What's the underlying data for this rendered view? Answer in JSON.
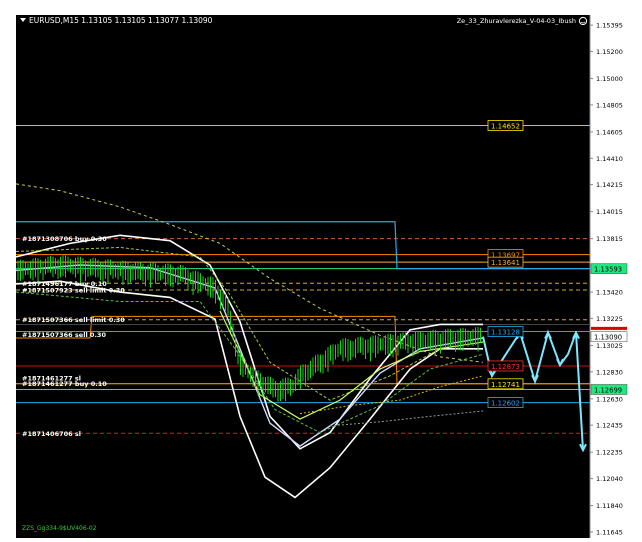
{
  "header": {
    "title": "EURUSD,M15  1.13105 1.13105 1.13077 1.13090",
    "indicator": "Ze_33_Zhuravlerezka_V-04-03_Ibush"
  },
  "footer": {
    "label": "ZZS_Gg334-9$UV406-02"
  },
  "colors": {
    "background": "#000000",
    "axis": "#c8c8c8",
    "candles": "#22cc22",
    "envelope": "#ffffff",
    "inner_band": "#cfd8ff",
    "ma_fast": "#ccff66",
    "ma_slow": "#9acd32",
    "forecast": "#7fe6ff",
    "green_line": "#20e880",
    "cyan_line": "#22aaee",
    "red_line": "#cc1111",
    "gold_line": "#e8c000",
    "orange_line": "#ff8800"
  },
  "chart_data": {
    "type": "line",
    "symbol": "EURUSD",
    "timeframe": "M15",
    "ylim": [
      1.116,
      1.1547
    ],
    "y_ticks": [
      "1.15395",
      "1.15200",
      "1.15000",
      "1.14805",
      "1.14605",
      "1.14410",
      "1.14215",
      "1.14015",
      "1.13815",
      "1.13615",
      "1.13420",
      "1.13225",
      "1.13025",
      "1.12830",
      "1.12630",
      "1.12435",
      "1.12235",
      "1.12040",
      "1.11840",
      "1.11645"
    ],
    "y_tick_values": [
      1.15395,
      1.152,
      1.15,
      1.14805,
      1.14605,
      1.1441,
      1.14215,
      1.14015,
      1.13815,
      1.13615,
      1.1342,
      1.13225,
      1.13025,
      1.1283,
      1.1263,
      1.12435,
      1.12235,
      1.1204,
      1.1184,
      1.11645
    ],
    "price_badges": [
      {
        "label": "1.13593",
        "value": 1.13593,
        "bg": "#20e880",
        "fg": "#000000"
      },
      {
        "label": "1.13090",
        "value": 1.1309,
        "bg": "#ffffff",
        "fg": "#000000"
      },
      {
        "label": "1.12699",
        "value": 1.12699,
        "bg": "#20e880",
        "fg": "#000000"
      }
    ],
    "horizontal_levels": [
      {
        "value": 1.14652,
        "color": "#e8c000",
        "tag": "1.14652",
        "tag_color": "#ffe600"
      },
      {
        "value": 1.13593,
        "color": "#20e880"
      },
      {
        "value": 1.12699,
        "color": "#20e880"
      },
      {
        "value": 1.13697,
        "color": "#ff8800",
        "tag": "1.13697",
        "tag_color": "#ff8800"
      },
      {
        "value": 1.13641,
        "color": "#ffaa33",
        "tag": "1.13641",
        "tag_color": "#ffaa33"
      },
      {
        "value": 1.13128,
        "color": "#22aaee",
        "tag": "1.13128",
        "tag_color": "#22aaee"
      },
      {
        "value": 1.12873,
        "color": "#cc1111",
        "tag": "1.12873",
        "tag_color": "#ff3333"
      },
      {
        "value": 1.12741,
        "color": "#e8c000",
        "tag": "1.12741",
        "tag_color": "#ffe600"
      },
      {
        "value": 1.12602,
        "color": "#22aaee",
        "tag": "1.12602",
        "tag_color": "#22aaee"
      }
    ],
    "orders": [
      {
        "label": "#1871308706 buy 0.30",
        "value": 1.13815
      },
      {
        "label": "#1871496177 buy 0.10",
        "value": 1.13485
      },
      {
        "label": "#1871507923 sell limit 0.30",
        "value": 1.13435
      },
      {
        "label": "#1871507366 sell limit 0.30",
        "value": 1.13215
      },
      {
        "label": "#1871507366 sell 0.30",
        "value": 1.13105
      },
      {
        "label": "#1871461277 sl",
        "value": 1.12785
      },
      {
        "label": "#1871461277 buy 0.10",
        "value": 1.12745
      },
      {
        "label": "#1871406706 sl",
        "value": 1.12375
      }
    ]
  }
}
